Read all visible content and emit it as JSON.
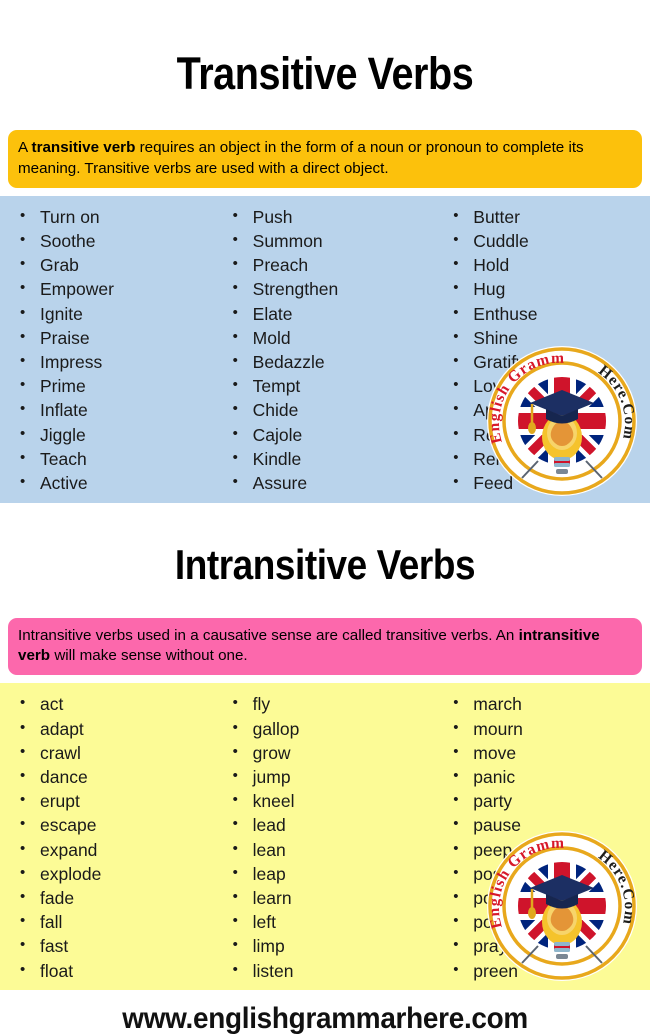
{
  "transitive": {
    "title": "Transitive Verbs",
    "definition_prefix": "A ",
    "definition_bold": "transitive verb",
    "definition_rest": " requires an object in the form of a noun or pronoun to complete its meaning. Transitive verbs are used with a direct object.",
    "panel_color": "#b9d3eb",
    "callout_color": "#fcc10c",
    "columns": [
      [
        "Turn on",
        "Soothe",
        "Grab",
        "Empower",
        "Ignite",
        "Praise",
        "Impress",
        "Prime",
        "Inflate",
        "Jiggle",
        "Teach",
        "Active"
      ],
      [
        "Push",
        "Summon",
        "Preach",
        "Strengthen",
        "Elate",
        "Mold",
        "Bedazzle",
        "Tempt",
        "Chide",
        "Cajole",
        "Kindle",
        "Assure"
      ],
      [
        "Butter",
        "Cuddle",
        "Hold",
        "Hug",
        "Enthuse",
        "Shine",
        "Gratify",
        "Love",
        "Appraise",
        "Relieve",
        "Relax",
        "Feed"
      ]
    ]
  },
  "intransitive": {
    "title": "Intransitive Verbs",
    "definition_prefix": "Intransitive verbs used in a causative sense are called transitive verbs. An ",
    "definition_bold": "intransitive verb",
    "definition_rest": " will make sense without one.",
    "panel_color": "#fcfb96",
    "callout_color": "#fc68ac",
    "columns": [
      [
        "act",
        "adapt",
        "crawl",
        "dance",
        "erupt",
        "escape",
        "expand",
        "explode",
        "fade",
        "fall",
        "fast",
        "float"
      ],
      [
        "fly",
        "gallop",
        "grow",
        "jump",
        "kneel",
        "lead",
        "lean",
        "leap",
        "learn",
        "left",
        "limp",
        "listen"
      ],
      [
        "march",
        "mourn",
        "move",
        "panic",
        "party",
        "pause",
        "peep",
        "pose",
        "pounce",
        "pout",
        "pray",
        "preen"
      ]
    ]
  },
  "logo": {
    "text_left": "English Grammar",
    "text_right": "Here.Com",
    "ring_color": "#e8a81c",
    "left_text_color": "#d7182a",
    "right_text_color": "#1d1d1b"
  },
  "footer": {
    "url": "www.englishgrammarhere.com"
  }
}
